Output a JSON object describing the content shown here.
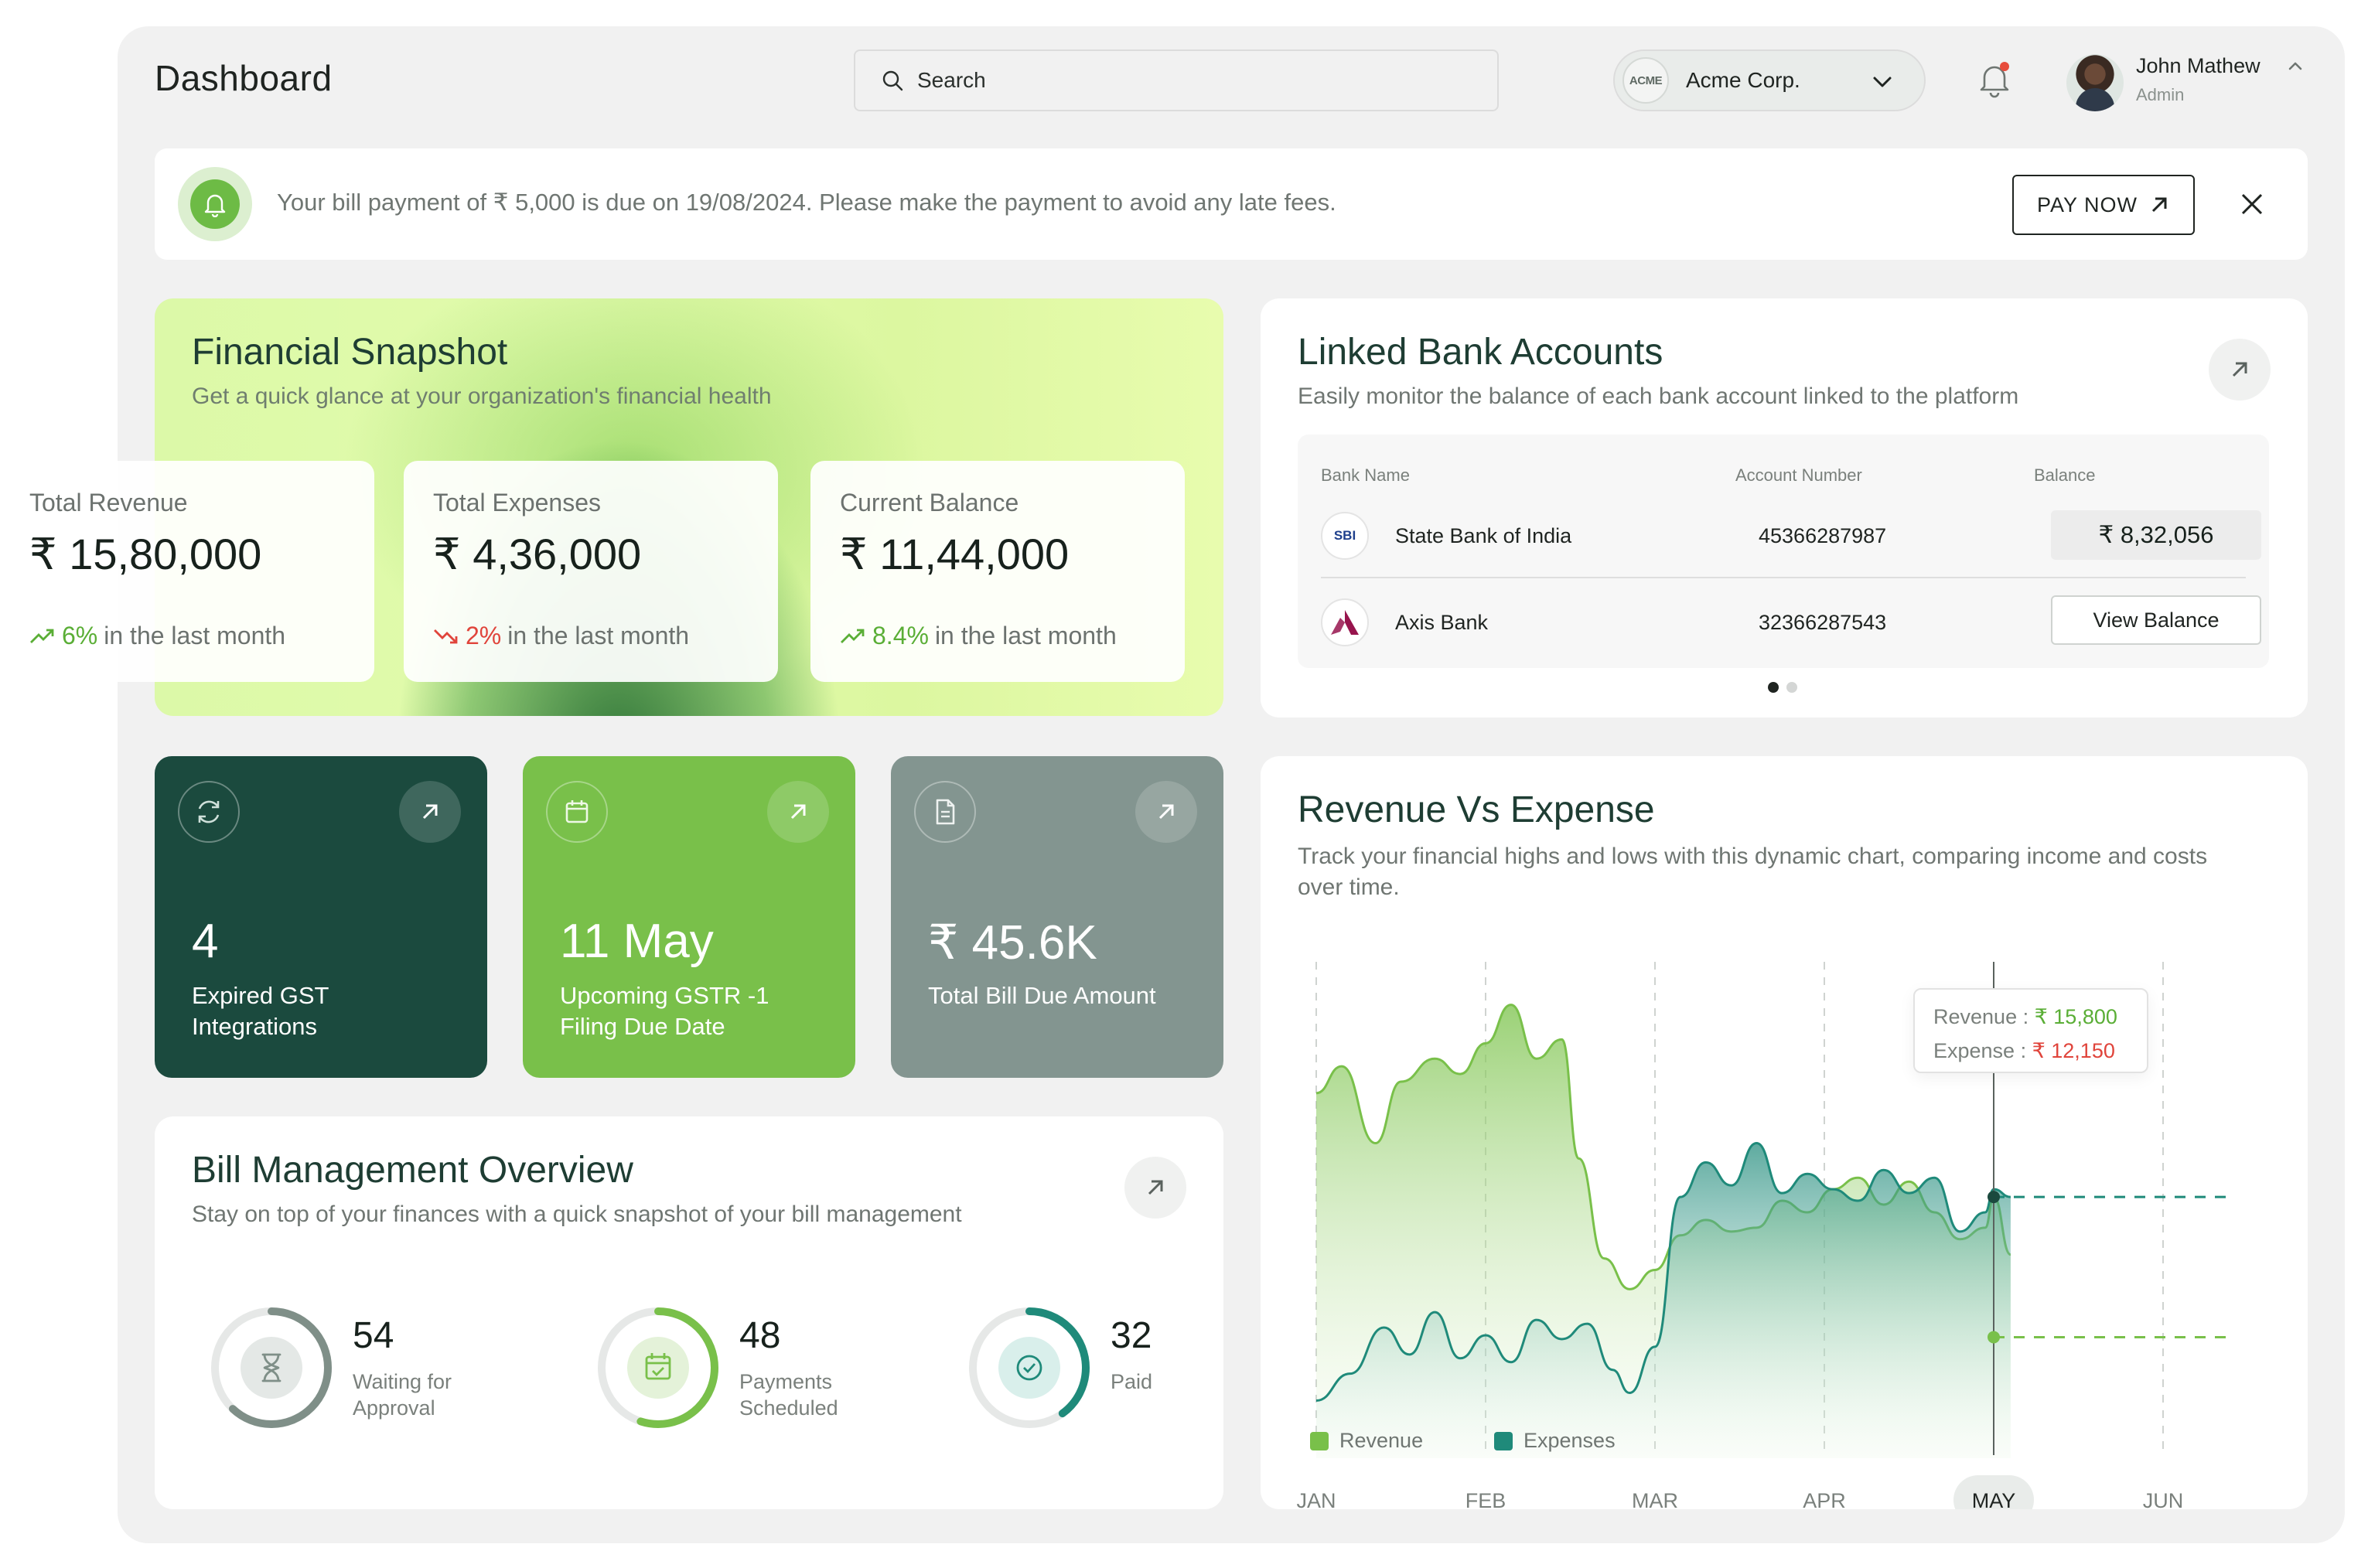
{
  "header": {
    "title": "Dashboard",
    "search_placeholder": "Search",
    "org": {
      "logo_text": "ACME",
      "name": "Acme Corp."
    },
    "user": {
      "name": "John Mathew",
      "role": "Admin"
    }
  },
  "banner": {
    "message": "Your bill payment of ₹ 5,000 is due on 19/08/2024. Please make the payment to avoid any late fees.",
    "pay_label": "PAY NOW"
  },
  "snapshot": {
    "title": "Financial Snapshot",
    "subtitle": "Get a quick glance at your organization's financial health",
    "stats": [
      {
        "label": "Total Revenue",
        "value": "₹ 15,80,000",
        "pct": "6%",
        "direction": "up",
        "suffix": "in the last month"
      },
      {
        "label": "Total Expenses",
        "value": "₹ 4,36,000",
        "pct": "2%",
        "direction": "down",
        "suffix": "in the last month"
      },
      {
        "label": "Current Balance",
        "value": "₹ 11,44,000",
        "pct": "8.4%",
        "direction": "up",
        "suffix": "in the last month"
      }
    ]
  },
  "banks": {
    "title": "Linked Bank Accounts",
    "subtitle": "Easily monitor the balance of each bank account linked to the platform",
    "columns": [
      "Bank Name",
      "Account Number",
      "Balance"
    ],
    "rows": [
      {
        "logo": "SBI",
        "name": "State Bank of India",
        "account": "45366287987",
        "balance": "₹ 8,32,056"
      },
      {
        "logo": "axis",
        "name": "Axis Bank",
        "account": "32366287543",
        "action": "View Balance"
      }
    ],
    "pages": 2,
    "active_page": 1
  },
  "kpis": [
    {
      "value": "4",
      "label": "Expired GST Integrations",
      "icon": "refresh-icon",
      "color": "#1b4a3e"
    },
    {
      "value": "11 May",
      "label": "Upcoming GSTR -1 Filing Due Date",
      "icon": "calendar-icon",
      "color": "#79c04a"
    },
    {
      "value": "₹ 45.6K",
      "label": "Total Bill Due Amount",
      "icon": "document-icon",
      "color": "#839590"
    }
  ],
  "bills": {
    "title": "Bill Management Overview",
    "subtitle": "Stay on top of your finances with a quick snapshot of your bill management",
    "items": [
      {
        "count": "54",
        "label": "Waiting for Approval",
        "icon": "hourglass-icon",
        "progress": 0.62,
        "color": "#7f8f88"
      },
      {
        "count": "48",
        "label": "Payments Scheduled",
        "icon": "calendar-check-icon",
        "progress": 0.55,
        "color": "#79c04a"
      },
      {
        "count": "32",
        "label": "Paid",
        "icon": "check-circle-icon",
        "progress": 0.4,
        "color": "#1f8a7a"
      }
    ]
  },
  "revenue_chart": {
    "title": "Revenue Vs Expense",
    "subtitle": "Track your financial highs and lows with this dynamic chart, comparing income and costs over time.",
    "tooltip": {
      "revenue_label": "Revenue :",
      "revenue_value": "₹ 15,800",
      "expense_label": "Expense :",
      "expense_value": "₹ 12,150"
    },
    "legend": [
      "Revenue",
      "Expenses"
    ],
    "colors": {
      "revenue": "#79c04a",
      "expenses": "#1f8a7a"
    }
  },
  "chart_data": {
    "type": "area",
    "categories": [
      "JAN",
      "FEB",
      "MAR",
      "APR",
      "MAY",
      "JUN"
    ],
    "highlighted_category": "MAY",
    "series": [
      {
        "name": "Revenue",
        "x": [
          0.0,
          0.15,
          0.35,
          0.5,
          0.7,
          0.85,
          1.0,
          1.15,
          1.3,
          1.45,
          1.55,
          1.7,
          1.85,
          2.0,
          2.15,
          2.3,
          2.45,
          2.6,
          2.75,
          2.9,
          3.05,
          3.2,
          3.35,
          3.5,
          3.65,
          3.8,
          3.95,
          4.0,
          4.1
        ],
        "values": [
          18500,
          19200,
          17200,
          18800,
          19400,
          19000,
          19800,
          20800,
          19400,
          19900,
          16800,
          14200,
          13400,
          13900,
          14800,
          15200,
          14900,
          15000,
          15700,
          15400,
          16000,
          16300,
          15600,
          16200,
          15400,
          14700,
          15000,
          15800,
          14300
        ]
      },
      {
        "name": "Expenses",
        "x": [
          0.0,
          0.2,
          0.4,
          0.55,
          0.7,
          0.85,
          1.0,
          1.15,
          1.3,
          1.45,
          1.6,
          1.75,
          1.85,
          2.0,
          2.15,
          2.3,
          2.45,
          2.6,
          2.75,
          2.9,
          3.05,
          3.2,
          3.35,
          3.5,
          3.65,
          3.8,
          3.95,
          4.0,
          4.1
        ],
        "values": [
          10500,
          11200,
          12400,
          11700,
          12800,
          11600,
          12200,
          11500,
          12600,
          12100,
          12500,
          11300,
          10700,
          11900,
          15800,
          16700,
          16100,
          17200,
          15900,
          16400,
          16000,
          15700,
          16500,
          15900,
          16300,
          14900,
          15400,
          16000,
          15800
        ]
      }
    ],
    "tooltip_at": "MAY",
    "tooltip_values": {
      "Revenue": 15800,
      "Expenses": 12150
    },
    "ylim": [
      9000,
      22000
    ],
    "grid": true,
    "legend_position": "bottom-left"
  }
}
